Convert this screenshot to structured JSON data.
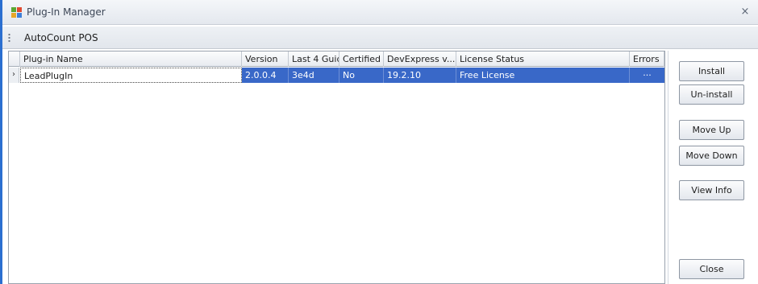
{
  "window": {
    "title": "Plug-In Manager",
    "close_glyph": "×"
  },
  "toolbar": {
    "title": "AutoCount POS"
  },
  "grid": {
    "columns": [
      "Plug-in Name",
      "Version",
      "Last 4 Guid",
      "Certified",
      "DevExpress v...",
      "License Status",
      "Errors"
    ],
    "rows": [
      {
        "indicator": "›",
        "name": "LeadPlugIn",
        "version": "2.0.0.4",
        "guid": "3e4d",
        "certified": "No",
        "devexpress": "19.2.10",
        "license": "Free License",
        "errors": "···"
      }
    ]
  },
  "buttons": {
    "install": "Install",
    "uninstall": "Un-install",
    "move_up": "Move Up",
    "move_down": "Move Down",
    "view_info": "View Info",
    "close": "Close"
  },
  "colors": {
    "selection": "#3968c8",
    "accent_edge": "#2b6fd0"
  }
}
